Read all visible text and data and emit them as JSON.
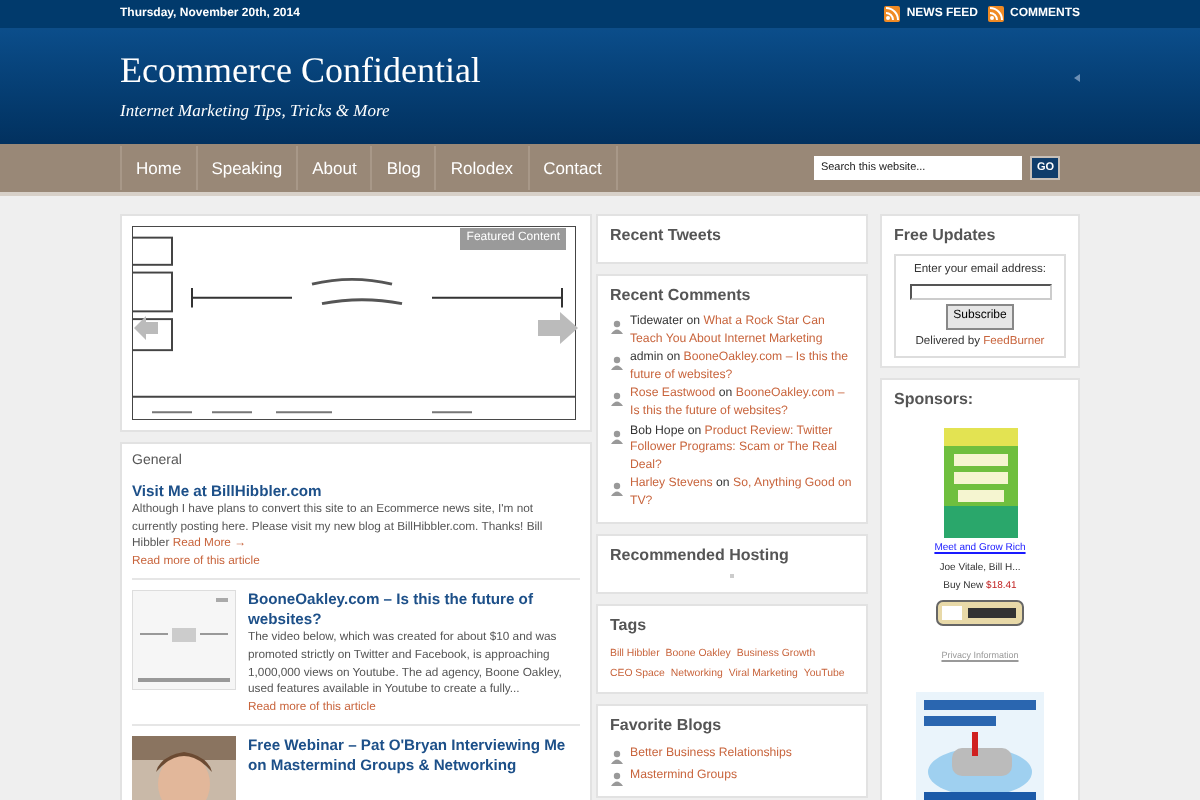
{
  "top_bar": {
    "date": "Thursday, November 20th, 2014",
    "feeds": [
      "NEWS FEED",
      "COMMENTS"
    ]
  },
  "header": {
    "title": "Ecommerce Confidential",
    "tagline": "Internet Marketing Tips, Tricks & More"
  },
  "nav": {
    "items": [
      "Home",
      "Speaking",
      "About",
      "Blog",
      "Rolodex",
      "Contact"
    ]
  },
  "search": {
    "placeholder": "Search this website...",
    "button": "GO"
  },
  "featured": {
    "badge": "Featured Content"
  },
  "general": {
    "heading": "General",
    "posts": [
      {
        "kind": "text",
        "title": "Visit Me at BillHibbler.com",
        "excerpt": "Although I have plans to convert this site to an Ecommerce news site, I'm not currently posting here. Please visit my new blog at BillHibbler.com. Thanks! Bill Hibbler",
        "read_more": "Read More →",
        "article_link": "Read more of this article"
      },
      {
        "kind": "thumb",
        "title": "BooneOakley.com – Is this the future of websites?",
        "excerpt": "The video below, which was created for about $10 and was promoted strictly on Twitter and Facebook, is approaching 1,000,000 views on Youtube. The ad agency, Boone Oakley, used features available in Youtube to create a fully...",
        "article_link": "Read more of this article"
      },
      {
        "title": "Free Webinar – Pat O'Bryan Interviewing Me on Mastermind Groups & Networking"
      }
    ]
  },
  "recent_tweets": {
    "heading": "Recent Tweets"
  },
  "recent_comments": {
    "heading": "Recent Comments",
    "items": [
      {
        "author": "Tidewater",
        "author_link": false,
        "on": "on",
        "post": "What a Rock Star Can Teach You About Internet Marketing"
      },
      {
        "author": "admin",
        "author_link": false,
        "on": "on",
        "post": "BooneOakley.com – Is this the future of websites?"
      },
      {
        "author": "Rose Eastwood",
        "author_link": true,
        "on": "on",
        "post": "BooneOakley.com – Is this the future of websites?"
      },
      {
        "author": "Bob Hope",
        "author_link": false,
        "on": "on",
        "post": "Product Review: Twitter Follower Programs: Scam or The Real Deal?"
      },
      {
        "author": "Harley Stevens",
        "author_link": true,
        "on": "on",
        "post": "So, Anything Good on TV?"
      }
    ]
  },
  "recommended_hosting": {
    "heading": "Recommended Hosting"
  },
  "tags": {
    "heading": "Tags",
    "items": [
      "Bill Hibbler",
      "Boone Oakley",
      "Business Growth",
      "CEO Space",
      "Networking",
      "Viral Marketing",
      "YouTube"
    ]
  },
  "favorite_blogs": {
    "heading": "Favorite Blogs",
    "items": [
      "Better Business Relationships",
      "Mastermind Groups"
    ]
  },
  "free_updates": {
    "heading": "Free Updates",
    "label": "Enter your email address:",
    "button": "Subscribe",
    "delivered_by": "Delivered by",
    "service": "FeedBurner"
  },
  "sponsors": {
    "heading": "Sponsors:",
    "book_link": "Meet and Grow Rich",
    "authors": "Joe Vitale, Bill H...",
    "buy_label": "Buy New",
    "price": "$18.41",
    "privacy": "Privacy Information"
  }
}
